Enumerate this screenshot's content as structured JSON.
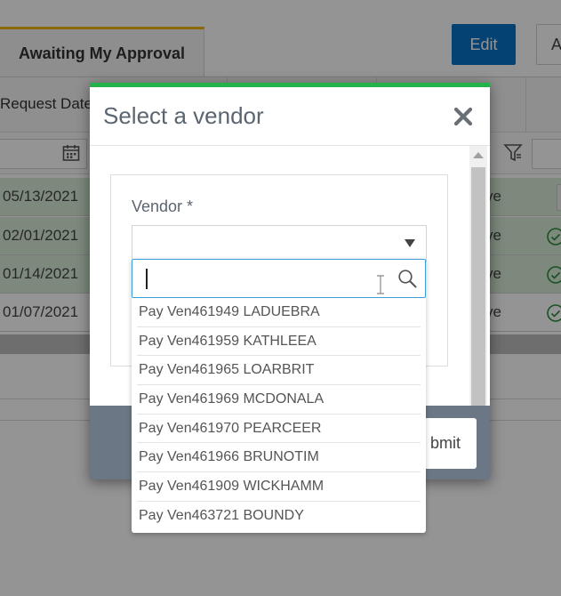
{
  "background": {
    "tab_label": "Awaiting My Approval",
    "edit_label": "Edit",
    "partial_button_label": "A",
    "column_header": "Request Date",
    "rows": [
      {
        "date": "05/13/2021",
        "status": "ve"
      },
      {
        "date": "02/01/2021",
        "status": "ve"
      },
      {
        "date": "01/14/2021",
        "status": "ve"
      },
      {
        "date": "01/07/2021",
        "status": "ve"
      }
    ]
  },
  "modal": {
    "title": "Select a vendor",
    "vendor_label": "Vendor *",
    "select_value": "",
    "search_value": "",
    "submit_label": "Submit",
    "submit_visible_label": "bmit",
    "options": [
      "Pay Ven461949 LADUEBRA",
      "Pay Ven461959 KATHLEEA",
      "Pay Ven461965 LOARBRIT",
      "Pay Ven461969 MCDONALA",
      "Pay Ven461970 PEARCEER",
      "Pay Ven461966 BRUNOTIM",
      "Pay Ven461909 WICKHAMM",
      "Pay Ven463721 BOUNDY"
    ]
  },
  "colors": {
    "accent_blue": "#0a73c8",
    "modal_top_border": "#22b24c",
    "tab_indicator": "#f0b400",
    "row_highlight": "#d6edd6",
    "footer": "#6b7785",
    "search_focus": "#3a9fd8"
  }
}
